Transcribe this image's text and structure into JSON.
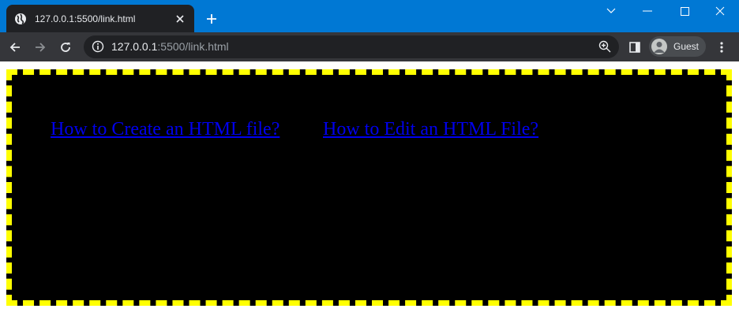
{
  "browser": {
    "tab": {
      "title": "127.0.0.1:5500/link.html",
      "favicon": "globe-icon"
    },
    "address": {
      "host": "127.0.0.1",
      "rest": ":5500/link.html"
    },
    "profile": {
      "label": "Guest"
    },
    "colors": {
      "titlebar": "#0078d4",
      "toolbar": "#35363a",
      "omnibox": "#202124"
    }
  },
  "page": {
    "links": [
      {
        "text": "How to Create an HTML file?"
      },
      {
        "text": "How to Edit an HTML File?"
      }
    ],
    "colors": {
      "background": "#000000",
      "border": "#ffff00",
      "link": "#0000ee"
    }
  }
}
